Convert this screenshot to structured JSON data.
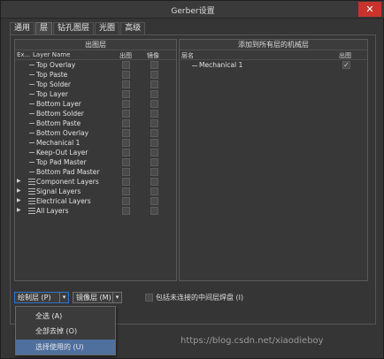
{
  "window": {
    "title": "Gerber设置",
    "close_glyph": "✕"
  },
  "tabs": [
    "通用",
    "层",
    "钻孔图层",
    "光圈",
    "高级"
  ],
  "left_panel": {
    "header": "出图层",
    "columns": {
      "ex": "Ex...",
      "name": "Layer Name",
      "plot": "出图",
      "mirror": "镜像"
    },
    "layers": [
      {
        "name": "Top Overlay",
        "kind": "leaf"
      },
      {
        "name": "Top Paste",
        "kind": "leaf"
      },
      {
        "name": "Top Solder",
        "kind": "leaf"
      },
      {
        "name": "Top Layer",
        "kind": "leaf"
      },
      {
        "name": "Bottom Layer",
        "kind": "leaf"
      },
      {
        "name": "Bottom Solder",
        "kind": "leaf"
      },
      {
        "name": "Bottom Paste",
        "kind": "leaf"
      },
      {
        "name": "Bottom Overlay",
        "kind": "leaf"
      },
      {
        "name": "Mechanical 1",
        "kind": "leaf"
      },
      {
        "name": "Keep-Out Layer",
        "kind": "leaf"
      },
      {
        "name": "Top Pad Master",
        "kind": "leaf"
      },
      {
        "name": "Bottom Pad Master",
        "kind": "leaf"
      },
      {
        "name": "Component Layers",
        "kind": "group"
      },
      {
        "name": "Signal Layers",
        "kind": "group"
      },
      {
        "name": "Electrical Layers",
        "kind": "group"
      },
      {
        "name": "All Layers",
        "kind": "group"
      }
    ],
    "expander_glyph": "▶"
  },
  "right_panel": {
    "header": "添加到所有层的机械层",
    "columns": {
      "name": "层名",
      "plot": "出图"
    },
    "layers": [
      {
        "name": "Mechanical 1",
        "checked": true,
        "check_glyph": "✓"
      }
    ]
  },
  "bottom": {
    "plot_layers_dropdown": "绘制层 (P)",
    "mirror_layers_dropdown": "镜像层 (M)",
    "dropdown_arrow": "▾",
    "include_unconnected_label": "包括未连接的中间层焊盘 (I)"
  },
  "dropdown_menu": {
    "items": [
      {
        "label": "全选 (A)",
        "selected": false
      },
      {
        "label": "全部去掉 (O)",
        "selected": false
      },
      {
        "label": "选择使用的 (U)",
        "selected": true
      }
    ]
  },
  "watermark": "https://blog.csdn.net/xiaodieboy",
  "colors": {
    "selection": "#4f6f9d",
    "close_button": "#c8332b",
    "focus_border": "#2e73c7"
  }
}
